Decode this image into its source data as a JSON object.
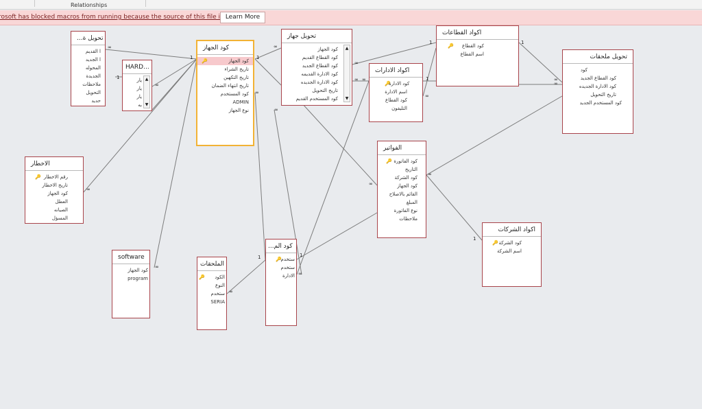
{
  "ribbon": {
    "relationships_label": "Relationships"
  },
  "message_bar": {
    "text": "rosoft has blocked macros from running because the source of this file is untrusted.",
    "learn_more": "Learn More"
  },
  "tables": {
    "tahwil_small": {
      "title": "...تحويل ة",
      "fields": [
        "ا القديم",
        "ا الجديد",
        "المحوله",
        "الجديدة",
        "ملاحظات",
        "التحويل",
        "حديد"
      ]
    },
    "hard": {
      "title": "HARD...",
      "fields": [
        "يار",
        "يار",
        "يار",
        "به"
      ]
    },
    "devices": {
      "title": "كود الجهاز",
      "fields": [
        "كود الجهاز",
        "تاريخ الشراء",
        "تاريخ التكهين",
        "تاريخ انتهاء الضمان",
        "كود المستخدم",
        "ADMIN",
        "نوع الجهاز"
      ]
    },
    "device_transfer": {
      "title": "تحويل جهاز",
      "fields": [
        "كود الجهاز",
        "كود القطاع القديم",
        "كود القطاع الجديد",
        "كود الادارة القديمه",
        "كود الادارة الجديده",
        "تاريخ التحويل",
        "كود المستخدم القديم"
      ]
    },
    "sectors": {
      "title": "اكواد القطاعات",
      "fields": [
        "كود القطاع",
        "اسم القطاع"
      ]
    },
    "departments": {
      "title": "اكواد الادارات",
      "fields": [
        "كود الادارة",
        "اسم الادارة",
        "كود القطاع",
        "التليفون"
      ]
    },
    "accessory_transfer": {
      "title": "تحويل ملحقات",
      "fields": [
        "كود",
        "كود القطاع الجديد",
        "كود الادارة الجديده",
        "تاريخ التحويل",
        "كود المستخدم الجديد"
      ]
    },
    "hazards": {
      "title": "الاخطار",
      "fields": [
        "رقم الاخطار",
        "تاريخ الاخطار",
        "كود الجهاز",
        "العطل",
        "الصيانه",
        "المسؤل"
      ]
    },
    "invoices": {
      "title": "الفواتير",
      "fields": [
        "كود الفاتورة",
        "التاريخ",
        "كود الشركة",
        "كود الجهاز",
        "القائم بالاصلاح",
        "المبلغ",
        "نوع الفاتورة",
        "ملاحظات"
      ]
    },
    "companies": {
      "title": "اكواد الشركات",
      "fields": [
        "كود الشركة",
        "اسم الشركة"
      ]
    },
    "software": {
      "title": "software",
      "fields": [
        "كود الجهاز",
        "program"
      ]
    },
    "accessories": {
      "title": "الملحقات",
      "fields": [
        "الكود",
        "النوع",
        "ستخدم",
        "SERIA"
      ]
    },
    "users": {
      "title": "...كود الم",
      "fields": [
        "ستخدم",
        "ستخدم",
        "الادارة"
      ]
    }
  },
  "relationship_marks": {
    "one": "1",
    "many": "∞"
  },
  "colors": {
    "table_border": "#a8434a",
    "selected_border": "#f2b234",
    "selected_field": "#f7c9cc",
    "message_bar": "#f9d7d7",
    "line": "#7c7c7c"
  }
}
